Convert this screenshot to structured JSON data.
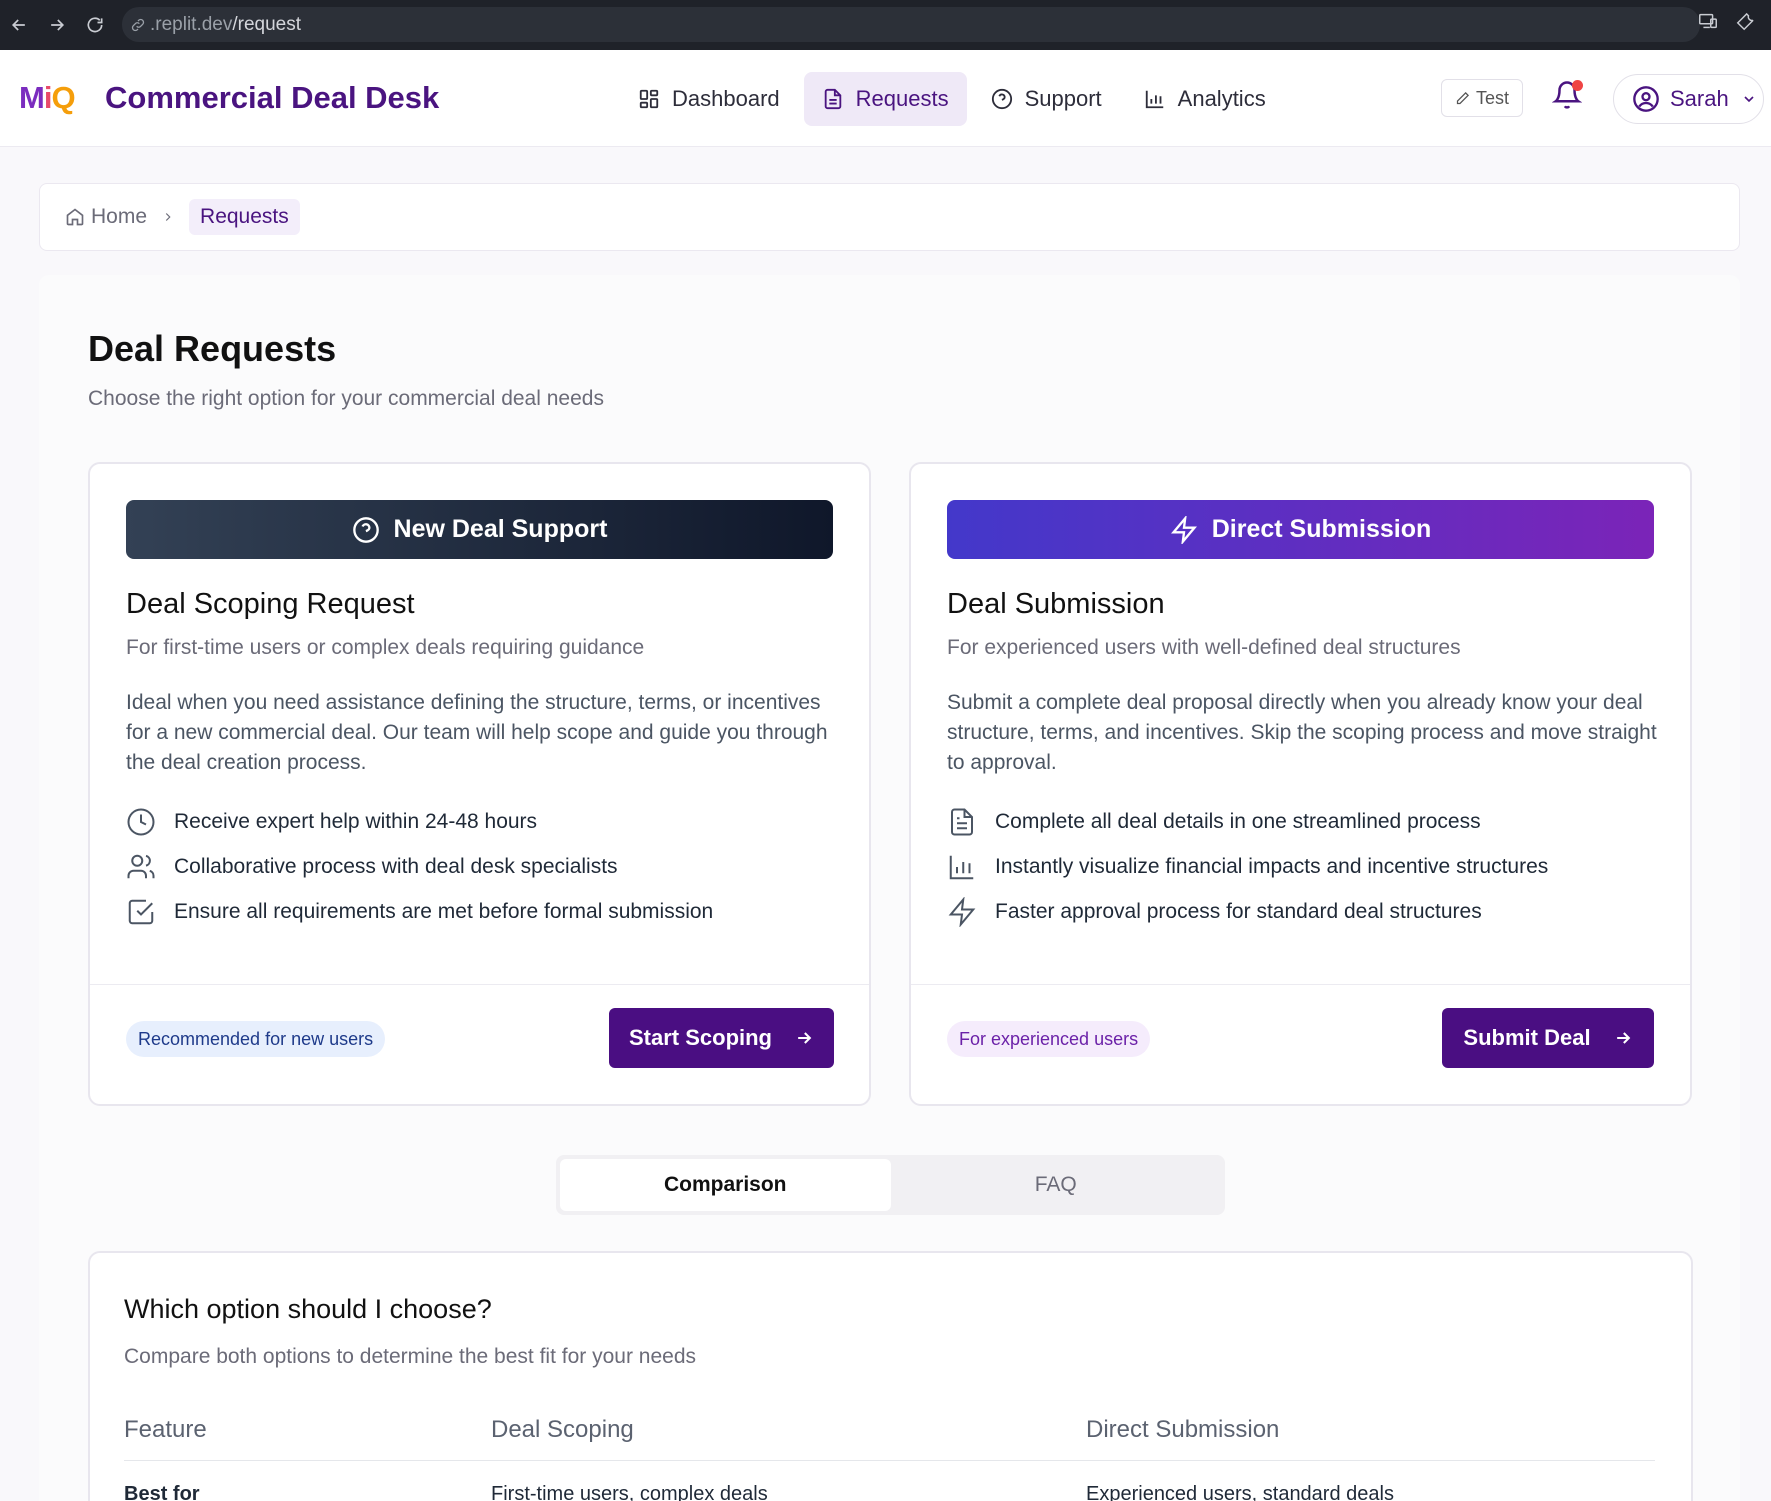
{
  "browser": {
    "url_host": ".replit.dev",
    "url_path": "/request"
  },
  "header": {
    "logo": {
      "m": "M",
      "i": "i",
      "q": "Q"
    },
    "title": "Commercial Deal Desk",
    "nav": [
      {
        "label": "Dashboard",
        "icon": "grid-icon"
      },
      {
        "label": "Requests",
        "icon": "document-icon",
        "active": true
      },
      {
        "label": "Support",
        "icon": "help-circle-icon"
      },
      {
        "label": "Analytics",
        "icon": "bar-chart-icon"
      }
    ],
    "test_label": "Test",
    "user_name": "Sarah"
  },
  "breadcrumb": {
    "home": "Home",
    "current": "Requests"
  },
  "page": {
    "title": "Deal Requests",
    "subtitle": "Choose the right option for your commercial deal needs"
  },
  "cards": [
    {
      "banner": "New Deal Support",
      "title": "Deal Scoping Request",
      "tagline": "For first-time users or complex deals requiring guidance",
      "description": "Ideal when you need assistance defining the structure, terms, or incentives for a new commercial deal. Our team will help scope and guide you through the deal creation process.",
      "features": [
        {
          "icon": "clock-icon",
          "text": "Receive expert help within 24-48 hours"
        },
        {
          "icon": "users-icon",
          "text": "Collaborative process with deal desk specialists"
        },
        {
          "icon": "check-square-icon",
          "text": "Ensure all requirements are met before formal submission"
        }
      ],
      "pill": "Recommended for new users",
      "cta": "Start Scoping"
    },
    {
      "banner": "Direct Submission",
      "title": "Deal Submission",
      "tagline": "For experienced users with well-defined deal structures",
      "description": "Submit a complete deal proposal directly when you already know your deal structure, terms, and incentives. Skip the scoping process and move straight to approval.",
      "features": [
        {
          "icon": "file-text-icon",
          "text": "Complete all deal details in one streamlined process"
        },
        {
          "icon": "bar-chart-icon",
          "text": "Instantly visualize financial impacts and incentive structures"
        },
        {
          "icon": "zap-icon",
          "text": "Faster approval process for standard deal structures"
        }
      ],
      "pill": "For experienced users",
      "cta": "Submit Deal"
    }
  ],
  "tabs": [
    {
      "label": "Comparison",
      "active": true
    },
    {
      "label": "FAQ",
      "active": false
    }
  ],
  "comparison": {
    "title": "Which option should I choose?",
    "subtitle": "Compare both options to determine the best fit for your needs",
    "headers": [
      "Feature",
      "Deal Scoping",
      "Direct Submission"
    ],
    "rows": [
      [
        "Best for",
        "First-time users, complex deals",
        "Experienced users, standard deals"
      ]
    ]
  },
  "colors": {
    "brand": "#4a0e82",
    "accent_purple": "#7b24b8",
    "accent_indigo": "#4338ca",
    "notification": "#ef4444"
  }
}
